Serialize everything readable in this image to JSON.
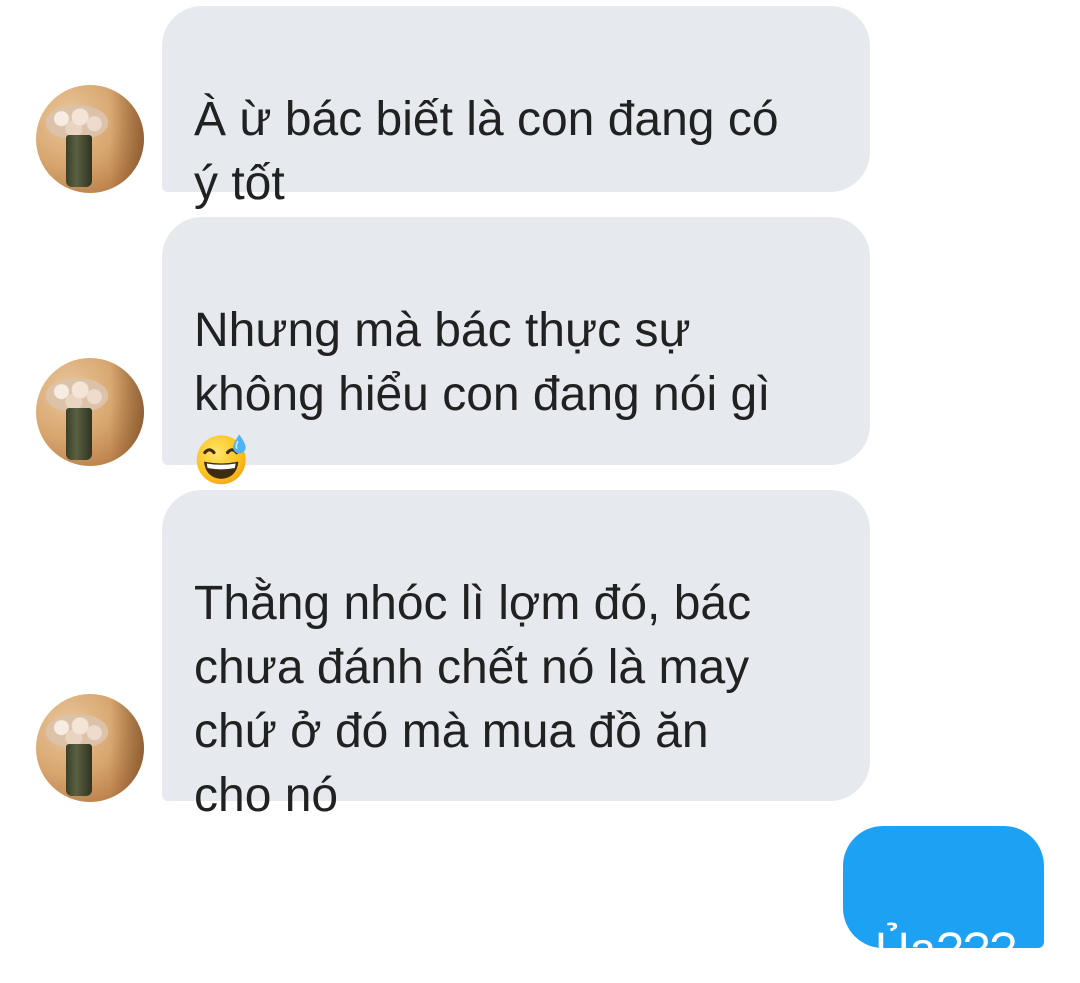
{
  "conversation": {
    "messages": [
      {
        "sender": "other",
        "text": "À ừ bác biết là con đang có\ný tốt"
      },
      {
        "sender": "other",
        "text": "Nhưng mà bác thực sự\nkhông hiểu con đang nói gì",
        "emoji": "grinning-face-with-sweat"
      },
      {
        "sender": "other",
        "text": "Thằng nhóc lì lợm đó, bác\nchưa đánh chết nó là may\nchứ ở đó mà mua đồ ăn\ncho nó"
      },
      {
        "sender": "me",
        "text": "Ủa???"
      }
    ]
  },
  "colors": {
    "incoming_bubble": "#e6eaee",
    "outgoing_bubble": "#1da1f2",
    "text": "#212121",
    "outgoing_text": "#ffffff"
  },
  "icons": {
    "avatar": "avatar-image",
    "emoji": "grinning-face-with-sweat-emoji"
  }
}
